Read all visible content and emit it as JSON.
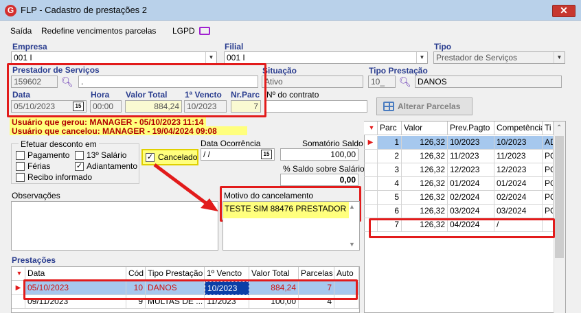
{
  "window": {
    "title": "FLP - Cadastro de prestações 2",
    "close_glyph": "✕",
    "logo_letter": "G"
  },
  "menu": {
    "exit": "Saída",
    "redefine": "Redefine vencimentos parcelas",
    "lgpd": "LGPD"
  },
  "form": {
    "empresa_label": "Empresa",
    "empresa_value": "001 I",
    "filial_label": "Filial",
    "filial_value": "001 I",
    "tipo_label": "Tipo",
    "tipo_value": "Prestador de Serviços",
    "prestador_label": "Prestador de Serviços",
    "prestador_code": "159602",
    "prestador_name": ".",
    "situacao_label": "Situação",
    "situacao_value": "Ativo",
    "tipo_prestacao_label": "Tipo Prestação",
    "tipo_prestacao_code": "10_",
    "tipo_prestacao_name": "DANOS",
    "data_label": "Data",
    "data_value": "05/10/2023",
    "cal_glyph": "15",
    "hora_label": "Hora",
    "hora_value": "00:00",
    "valor_total_label": "Valor Total",
    "valor_total_value": "884,24",
    "primeiro_vencto_label": "1ª Vencto",
    "primeiro_vencto_value": "10/2023",
    "nr_parc_label": "Nr.Parc",
    "nr_parc_value": "7",
    "contrato_label": "Nº do contrato",
    "contrato_value": "",
    "alterar_parcelas": "Alterar Parcelas"
  },
  "audit": {
    "gerou": "Usuário que gerou: MANAGER - 05/10/2023 11:14",
    "cancelou": "Usuário que cancelou: MANAGER - 19/04/2024 09:08"
  },
  "desconto": {
    "title": "Efetuar desconto em",
    "pagamento": "Pagamento",
    "salario13": "13º Salário",
    "ferias": "Férias",
    "adiantamento": "Adiantamento",
    "recibo": "Recibo informado"
  },
  "cancelado": {
    "label": "Cancelado",
    "check": "✓"
  },
  "ocorrencia": {
    "label": "Data Ocorrência",
    "value": " / /"
  },
  "somatorio": {
    "label": "Somatório Saldo",
    "value": "100,00"
  },
  "saldo_pct": {
    "label": "% Saldo sobre Salário",
    "value": "0,00"
  },
  "observacoes_label": "Observações",
  "motivo": {
    "label": "Motivo do cancelamento",
    "value": "TESTE SIM 88476 PRESTADOR"
  },
  "prestacoes": {
    "title": "Prestações",
    "headers": [
      "Data",
      "Cód",
      "Tipo Prestação",
      "1º Vencto",
      "Valor Total",
      "Parcelas",
      "Auto"
    ],
    "rows": [
      {
        "data": "05/10/2023",
        "cod": "10",
        "tipo": "DANOS",
        "vencto": "10/2023",
        "valor": "884,24",
        "parcelas": "7"
      },
      {
        "data": "09/11/2023",
        "cod": "9",
        "tipo": "MULTAS DE ...",
        "vencto": "11/2023",
        "valor": "100,00",
        "parcelas": "4"
      }
    ]
  },
  "parcelas": {
    "headers": [
      "Parc",
      "Valor",
      "Prev.Pagto",
      "Competência",
      "Ti"
    ],
    "rows": [
      {
        "parc": "1",
        "valor": "126,32",
        "prev": "10/2023",
        "comp": "10/2023",
        "tipo": "AD"
      },
      {
        "parc": "2",
        "valor": "126,32",
        "prev": "11/2023",
        "comp": "11/2023",
        "tipo": "PG"
      },
      {
        "parc": "3",
        "valor": "126,32",
        "prev": "12/2023",
        "comp": "12/2023",
        "tipo": "PG"
      },
      {
        "parc": "4",
        "valor": "126,32",
        "prev": "01/2024",
        "comp": "01/2024",
        "tipo": "PG"
      },
      {
        "parc": "5",
        "valor": "126,32",
        "prev": "02/2024",
        "comp": "02/2024",
        "tipo": "PG"
      },
      {
        "parc": "6",
        "valor": "126,32",
        "prev": "03/2024",
        "comp": "03/2024",
        "tipo": "PG"
      },
      {
        "parc": "7",
        "valor": "126,32",
        "prev": "04/2024",
        "comp": " /",
        "tipo": ""
      }
    ]
  }
}
